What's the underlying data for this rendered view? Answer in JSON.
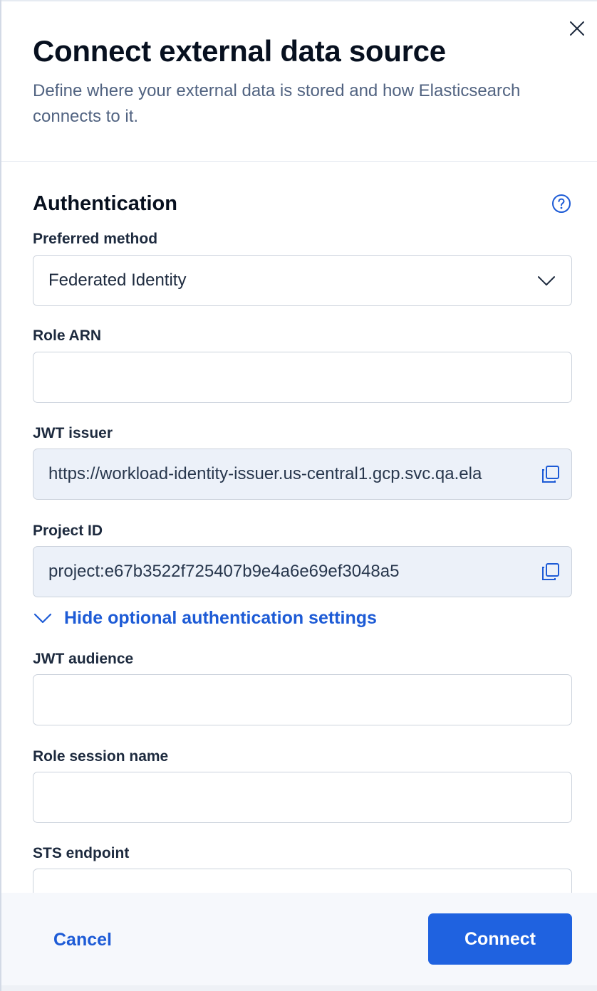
{
  "header": {
    "title": "Connect external data source",
    "subtitle": "Define where your external data is stored and how Elasticsearch connects to it."
  },
  "authentication": {
    "section_title": "Authentication",
    "preferred_method": {
      "label": "Preferred method",
      "selected": "Federated Identity"
    },
    "role_arn": {
      "label": "Role ARN",
      "value": ""
    },
    "jwt_issuer": {
      "label": "JWT issuer",
      "value": "https://workload-identity-issuer.us-central1.gcp.svc.qa.ela"
    },
    "project_id": {
      "label": "Project ID",
      "value": "project:e67b3522f725407b9e4a6e69ef3048a5"
    },
    "optional_toggle": "Hide optional authentication settings",
    "jwt_audience": {
      "label": "JWT audience",
      "value": ""
    },
    "role_session_name": {
      "label": "Role session name",
      "value": ""
    },
    "sts_endpoint": {
      "label": "STS endpoint",
      "value": ""
    }
  },
  "footer": {
    "cancel_label": "Cancel",
    "connect_label": "Connect"
  },
  "icons": {
    "close": "close-icon",
    "help": "question-circle-icon",
    "select_chevron": "chevron-down-icon",
    "copy": "copy-icon",
    "toggle_chevron": "chevron-down-icon"
  },
  "colors": {
    "accent": "#1d5bd6",
    "primary_button": "#1f62e0",
    "readonly_field": "#ecf1f9",
    "footer_bg": "#f6f8fc"
  }
}
